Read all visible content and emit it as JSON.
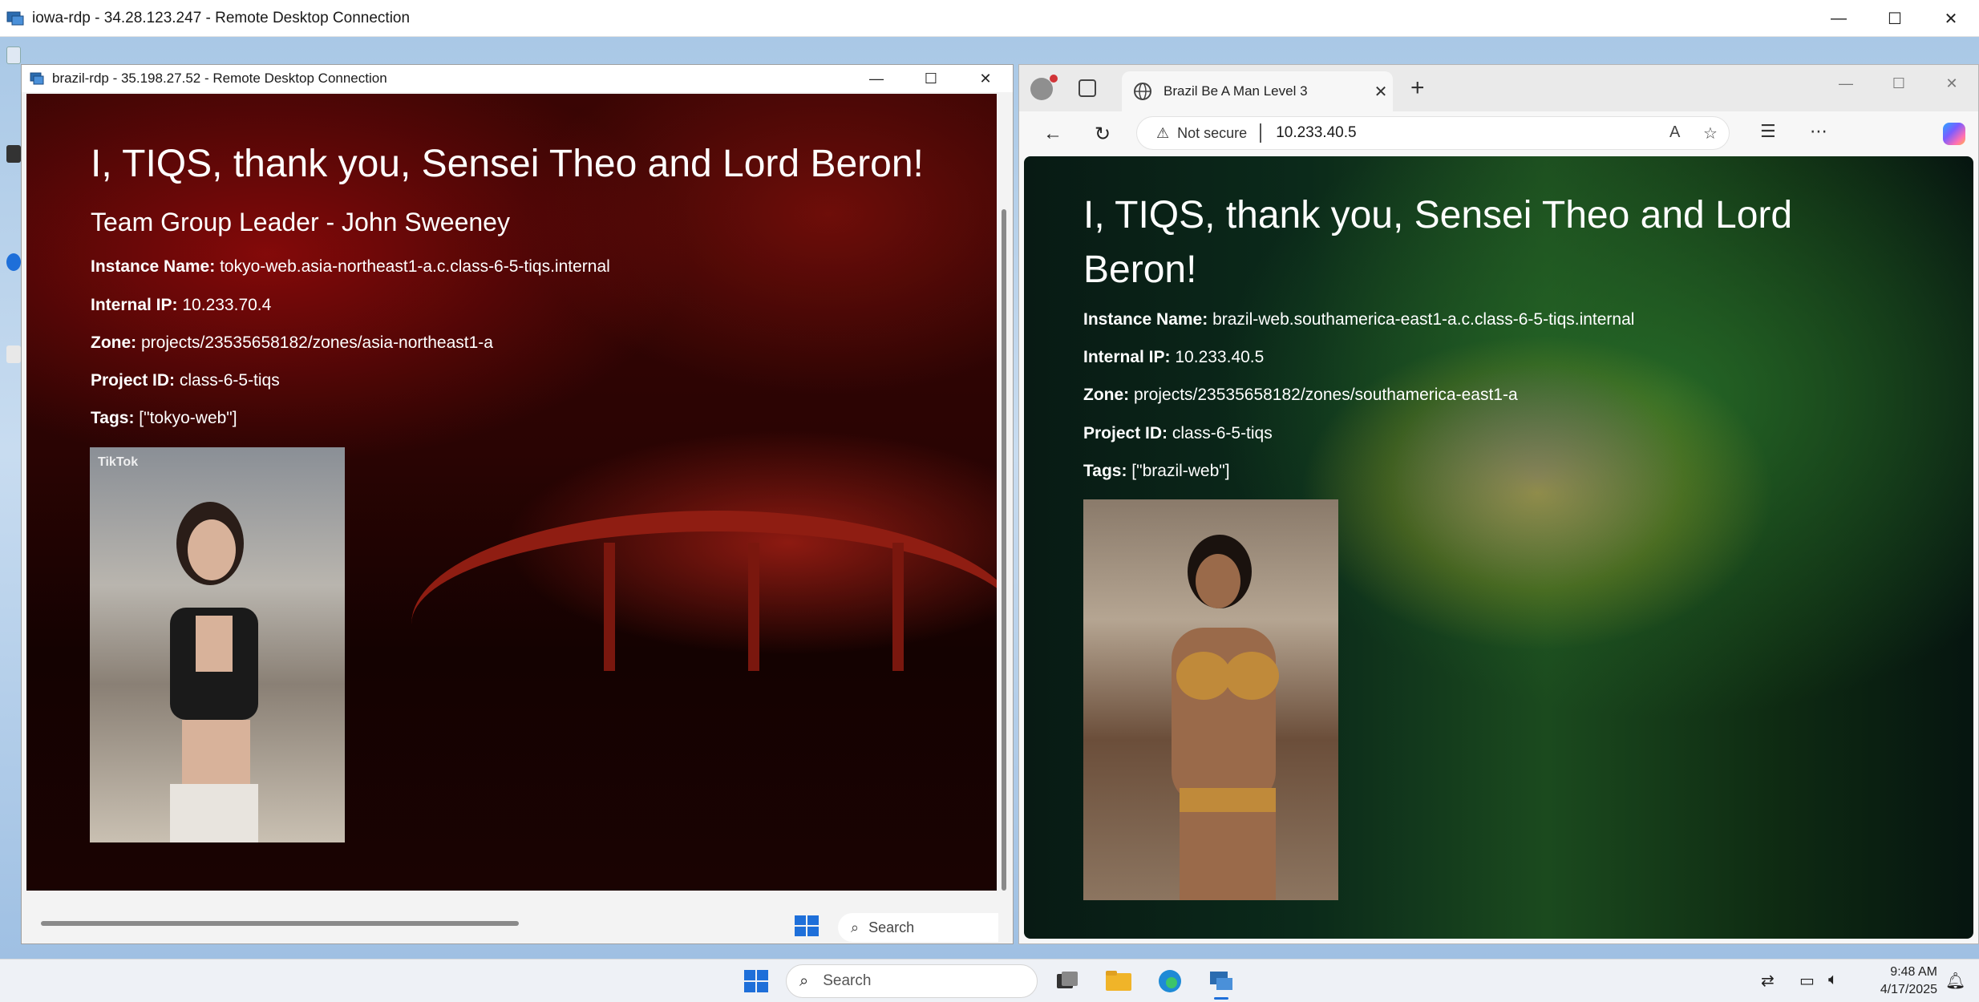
{
  "outer_window": {
    "title": "iowa-rdp - 34.28.123.247 - Remote Desktop Connection",
    "controls": {
      "minimize": "—",
      "maximize": "☐",
      "close": "✕"
    }
  },
  "rdp_window": {
    "title": "brazil-rdp - 35.198.27.52 - Remote Desktop Connection",
    "controls": {
      "minimize": "—",
      "maximize": "☐",
      "close": "✕"
    },
    "taskbar": {
      "search_label": "Search"
    }
  },
  "tokyo_page": {
    "heading": "I, TIQS, thank you, Sensei Theo and Lord Beron!",
    "subheading": "Team Group Leader - John Sweeney",
    "fields": [
      {
        "label": "Instance Name:",
        "value": "tokyo-web.asia-northeast1-a.c.class-6-5-tiqs.internal"
      },
      {
        "label": "Internal IP:",
        "value": "10.233.70.4"
      },
      {
        "label": "Zone:",
        "value": "projects/23535658182/zones/asia-northeast1-a"
      },
      {
        "label": "Project ID:",
        "value": "class-6-5-tiqs"
      },
      {
        "label": "Tags:",
        "value": "[\"tokyo-web\"]"
      }
    ],
    "image_watermark": "TikTok"
  },
  "browser": {
    "tab_title": "Brazil   Be A Man Level 3",
    "new_tab": "+",
    "controls": {
      "minimize": "—",
      "maximize": "☐",
      "close": "✕"
    },
    "security_label": "Not secure",
    "url": "10.233.40.5"
  },
  "brazil_page": {
    "heading": "I, TIQS, thank you, Sensei Theo and Lord Beron!",
    "fields": [
      {
        "label": "Instance Name:",
        "value": "brazil-web.southamerica-east1-a.c.class-6-5-tiqs.internal"
      },
      {
        "label": "Internal IP:",
        "value": "10.233.40.5"
      },
      {
        "label": "Zone:",
        "value": "projects/23535658182/zones/southamerica-east1-a"
      },
      {
        "label": "Project ID:",
        "value": "class-6-5-tiqs"
      },
      {
        "label": "Tags:",
        "value": "[\"brazil-web\"]"
      }
    ]
  },
  "taskbar": {
    "search_label": "Search",
    "time": "9:48 AM",
    "date": "4/17/2025",
    "apps": [
      "task-view",
      "file-explorer",
      "edge-browser",
      "remote-desktop"
    ]
  },
  "colors": {
    "windows_blue": "#1e6fd9",
    "tokyo_red": "#8f1d12",
    "brazil_green": "#1b4a1e",
    "brazil_yellow": "#e6c828"
  }
}
